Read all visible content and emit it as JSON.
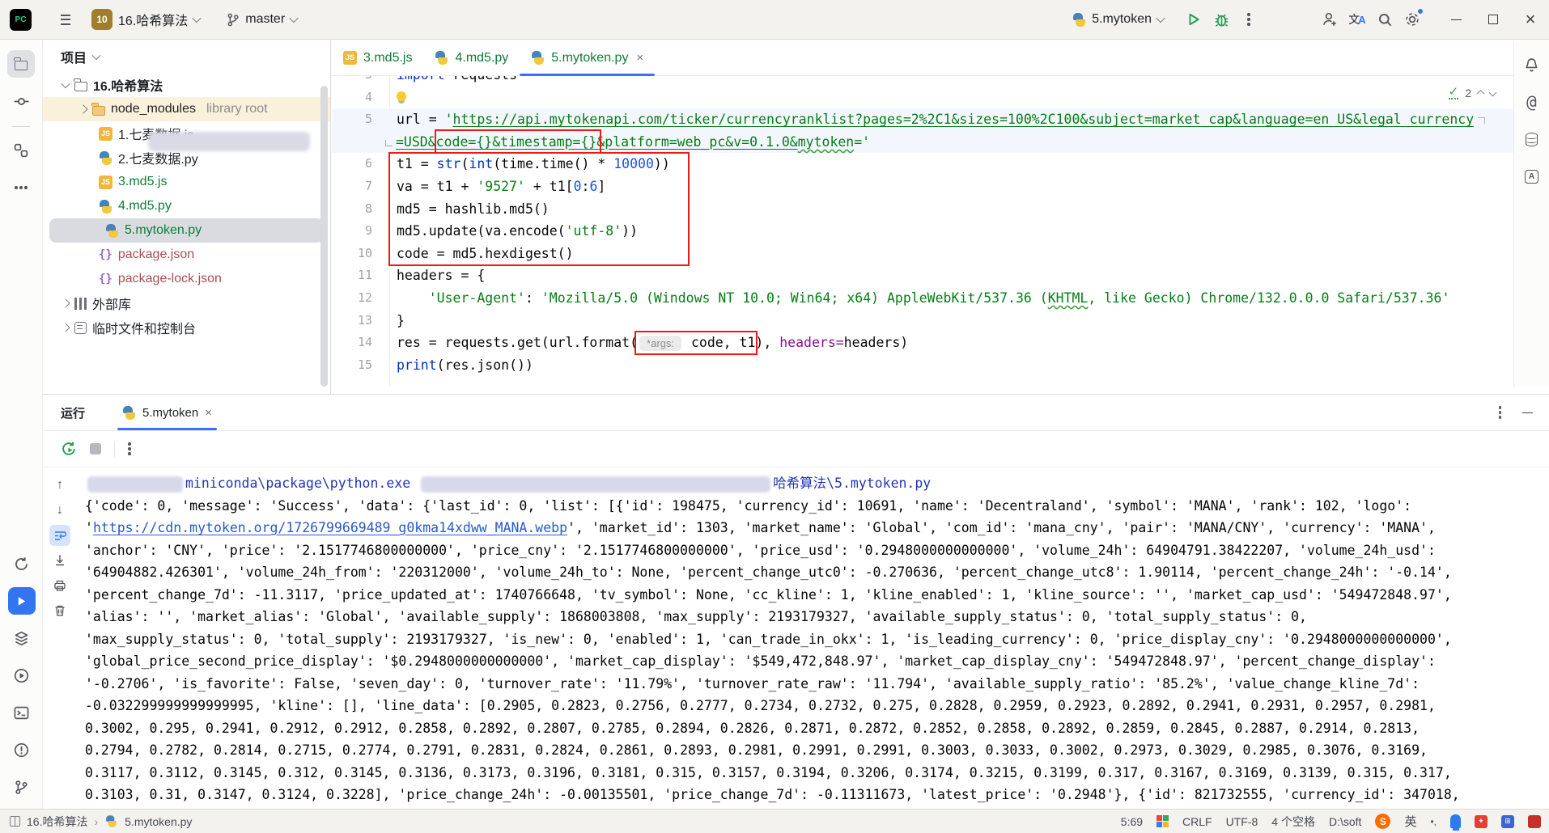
{
  "titlebar": {
    "logo_text": "PC",
    "project_badge": "10",
    "project_name": "16.哈希算法",
    "branch": "master",
    "run_config": "5.mytoken"
  },
  "project_panel": {
    "title": "项目",
    "tree": [
      {
        "label": "16.哈希算法",
        "icon": "folder",
        "chevron": "down",
        "indent": 0,
        "bold": true,
        "color": "plain",
        "blur_after": true
      },
      {
        "label": "node_modules",
        "suffix": "library root",
        "icon": "folder-orange",
        "chevron": "right",
        "indent": 1,
        "row": "libbg",
        "color": "plain"
      },
      {
        "label": "1.七麦数据.js",
        "icon": "js",
        "indent": 1,
        "color": "plain"
      },
      {
        "label": "2.七麦数据.py",
        "icon": "py",
        "indent": 1,
        "color": "plain"
      },
      {
        "label": "3.md5.js",
        "icon": "js",
        "indent": 1,
        "color": "green"
      },
      {
        "label": "4.md5.py",
        "icon": "py",
        "indent": 1,
        "color": "green"
      },
      {
        "label": "5.mytoken.py",
        "icon": "py",
        "indent": 1,
        "color": "green",
        "selected": true
      },
      {
        "label": "package.json",
        "icon": "json",
        "indent": 1,
        "color": "red"
      },
      {
        "label": "package-lock.json",
        "icon": "json",
        "indent": 1,
        "color": "red"
      },
      {
        "label": "外部库",
        "icon": "lib",
        "chevron": "right",
        "indent": 0,
        "color": "plain"
      },
      {
        "label": "临时文件和控制台",
        "icon": "scratch",
        "chevron": "right",
        "indent": 0,
        "color": "plain"
      }
    ]
  },
  "editor": {
    "tabs": [
      {
        "label": "3.md5.js",
        "icon": "js"
      },
      {
        "label": "4.md5.py",
        "icon": "py"
      },
      {
        "label": "5.mytoken.py",
        "icon": "py",
        "active": true,
        "close": true
      }
    ],
    "inspections_count": "2",
    "lines": [
      {
        "num": "3",
        "segs": [
          [
            "k",
            "import"
          ],
          [
            "p",
            " requests"
          ]
        ]
      },
      {
        "num": "4",
        "segs": [
          [
            "bulb",
            ""
          ]
        ]
      },
      {
        "num": "5",
        "caret": true,
        "segs": [
          [
            "p",
            "url = "
          ],
          [
            "s",
            "'"
          ],
          [
            "su",
            "https://api.mytokenapi.com/ticker/currencyranklist?pages=2%2C1&sizes=100%2C100&subject=market_cap&language=en_US&legal_currency"
          ],
          [
            "wm",
            ""
          ]
        ]
      },
      {
        "num": "",
        "caret": true,
        "wrap": true,
        "segs": [
          [
            "su",
            "=USD&code={}&timestamp={}&platform=web_pc&v=0.1.0&"
          ],
          [
            "sw",
            "mytoken"
          ],
          [
            "s",
            "='"
          ]
        ]
      },
      {
        "num": "6",
        "segs": [
          [
            "p",
            "t1 = "
          ],
          [
            "k",
            "str"
          ],
          [
            "p",
            "("
          ],
          [
            "k",
            "int"
          ],
          [
            "p",
            "(time.time() * "
          ],
          [
            "n",
            "10000"
          ],
          [
            "p",
            "))"
          ]
        ]
      },
      {
        "num": "7",
        "segs": [
          [
            "p",
            "va = t1 + "
          ],
          [
            "s",
            "'9527'"
          ],
          [
            "p",
            " + t1["
          ],
          [
            "n",
            "0"
          ],
          [
            "p",
            ":"
          ],
          [
            "n",
            "6"
          ],
          [
            "p",
            "]"
          ]
        ]
      },
      {
        "num": "8",
        "segs": [
          [
            "p",
            "md5 = hashlib.md5()"
          ]
        ]
      },
      {
        "num": "9",
        "segs": [
          [
            "p",
            "md5.update(va.encode("
          ],
          [
            "s",
            "'utf-8'"
          ],
          [
            "p",
            "))"
          ]
        ]
      },
      {
        "num": "10",
        "segs": [
          [
            "p",
            "code = md5.hexdigest()"
          ]
        ]
      },
      {
        "num": "11",
        "segs": [
          [
            "p",
            "headers = {"
          ]
        ]
      },
      {
        "num": "12",
        "segs": [
          [
            "p",
            "    "
          ],
          [
            "s",
            "'User-Agent'"
          ],
          [
            "p",
            ": "
          ],
          [
            "s",
            "'Mozilla/5.0 (Windows NT 10.0; Win64; x64) AppleWebKit/537.36 ("
          ],
          [
            "swavy",
            "KHTML"
          ],
          [
            "s",
            ", like Gecko) Chrome/132.0.0.0 Safari/537.36'"
          ]
        ]
      },
      {
        "num": "13",
        "segs": [
          [
            "p",
            "}"
          ]
        ]
      },
      {
        "num": "14",
        "segs": [
          [
            "p",
            "res = requests.get(url.format("
          ],
          [
            "inlay",
            "*args:"
          ],
          [
            "p",
            " code, t1), "
          ],
          [
            "pa",
            "headers="
          ],
          [
            "p",
            "headers)"
          ]
        ]
      },
      {
        "num": "15",
        "segs": [
          [
            "k",
            "print"
          ],
          [
            "p",
            "(res.json())"
          ]
        ]
      }
    ]
  },
  "run_panel": {
    "title": "运行",
    "tab": "5.mytoken",
    "console": {
      "path_line": [
        [
          "blur",
          "118"
        ],
        [
          "cmd",
          "miniconda\\package\\python.exe "
        ],
        [
          "blur",
          "432"
        ],
        [
          "cmd",
          "哈希算法\\5.mytoken.py"
        ]
      ],
      "lines": [
        [
          [
            "t",
            "{'code': 0, 'message': 'Success', 'data': {'last_id': 0, 'list': [{'id': 198475, 'currency_id': 10691, 'name': 'Decentraland', 'symbol': 'MANA', 'rank': 102, 'logo':"
          ]
        ],
        [
          [
            "t",
            "'"
          ],
          [
            "link",
            "https://cdn.mytoken.org/1726799669489_g0kma14xdww_MANA.webp"
          ],
          [
            "t",
            "', 'market_id': 1303, 'market_name': 'Global', 'com_id': 'mana_cny', 'pair': 'MANA/CNY', 'currency': 'MANA',"
          ]
        ],
        [
          [
            "t",
            "'anchor': 'CNY', 'price': '2.1517746800000000', 'price_cny': '2.1517746800000000', 'price_usd': '0.2948000000000000', 'volume_24h': 64904791.38422207, 'volume_24h_usd':"
          ]
        ],
        [
          [
            "t",
            "'64904882.426301', 'volume_24h_from': '220312000', 'volume_24h_to': None, 'percent_change_utc0': -0.270636, 'percent_change_utc8': 1.90114, 'percent_change_24h': '-0.14',"
          ]
        ],
        [
          [
            "t",
            "'percent_change_7d': -11.3117, 'price_updated_at': 1740766648, 'tv_symbol': None, 'cc_kline': 1, 'kline_enabled': 1, 'kline_source': '', 'market_cap_usd': '549472848.97',"
          ]
        ],
        [
          [
            "t",
            "'alias': '', 'market_alias': 'Global', 'available_supply': 1868003808, 'max_supply': 2193179327, 'available_supply_status': 0, 'total_supply_status': 0,"
          ]
        ],
        [
          [
            "t",
            "'max_supply_status': 0, 'total_supply': 2193179327, 'is_new': 0, 'enabled': 1, 'can_trade_in_okx': 1, 'is_leading_currency': 0, 'price_display_cny': '0.2948000000000000',"
          ]
        ],
        [
          [
            "t",
            "'global_price_second_price_display': '$0.2948000000000000', 'market_cap_display': '$549,472,848.97', 'market_cap_display_cny': '549472848.97', 'percent_change_display':"
          ]
        ],
        [
          [
            "t",
            "'-0.2706', 'is_favorite': False, 'seven_day': 0, 'turnover_rate': '11.79%', 'turnover_rate_raw': '11.794', 'available_supply_ratio': '85.2%', 'value_change_kline_7d':"
          ]
        ],
        [
          [
            "t",
            "-0.032299999999999995, 'kline': [], 'line_data': [0.2905, 0.2823, 0.2756, 0.2777, 0.2734, 0.2732, 0.275, 0.2828, 0.2959, 0.2923, 0.2892, 0.2941, 0.2931, 0.2957, 0.2981,"
          ]
        ],
        [
          [
            "t",
            "0.3002, 0.295, 0.2941, 0.2912, 0.2912, 0.2858, 0.2892, 0.2807, 0.2785, 0.2894, 0.2826, 0.2871, 0.2872, 0.2852, 0.2858, 0.2892, 0.2859, 0.2845, 0.2887, 0.2914, 0.2813,"
          ]
        ],
        [
          [
            "t",
            "0.2794, 0.2782, 0.2814, 0.2715, 0.2774, 0.2791, 0.2831, 0.2824, 0.2861, 0.2893, 0.2981, 0.2991, 0.2991, 0.3003, 0.3033, 0.3002, 0.2973, 0.3029, 0.2985, 0.3076, 0.3169,"
          ]
        ],
        [
          [
            "t",
            "0.3117, 0.3112, 0.3145, 0.312, 0.3145, 0.3136, 0.3173, 0.3196, 0.3181, 0.315, 0.3157, 0.3194, 0.3206, 0.3174, 0.3215, 0.3199, 0.317, 0.3167, 0.3169, 0.3139, 0.315, 0.317,"
          ]
        ],
        [
          [
            "t",
            "0.3103, 0.31, 0.3147, 0.3124, 0.3228], 'price_change_24h': -0.00135501, 'price_change_7d': -0.11311673, 'latest_price': '0.2948'}, {'id': 821732555, 'currency_id': 347018,"
          ]
        ]
      ]
    }
  },
  "status_bar": {
    "left_project": "16.哈希算法",
    "left_sep": "›",
    "left_file": "5.mytoken.py",
    "caret": "5:69",
    "line_sep": "CRLF",
    "encoding": "UTF-8",
    "indent": "4 个空格",
    "interpreter": "D:\\soft",
    "ime": "英",
    "ime_dots": "•,"
  }
}
